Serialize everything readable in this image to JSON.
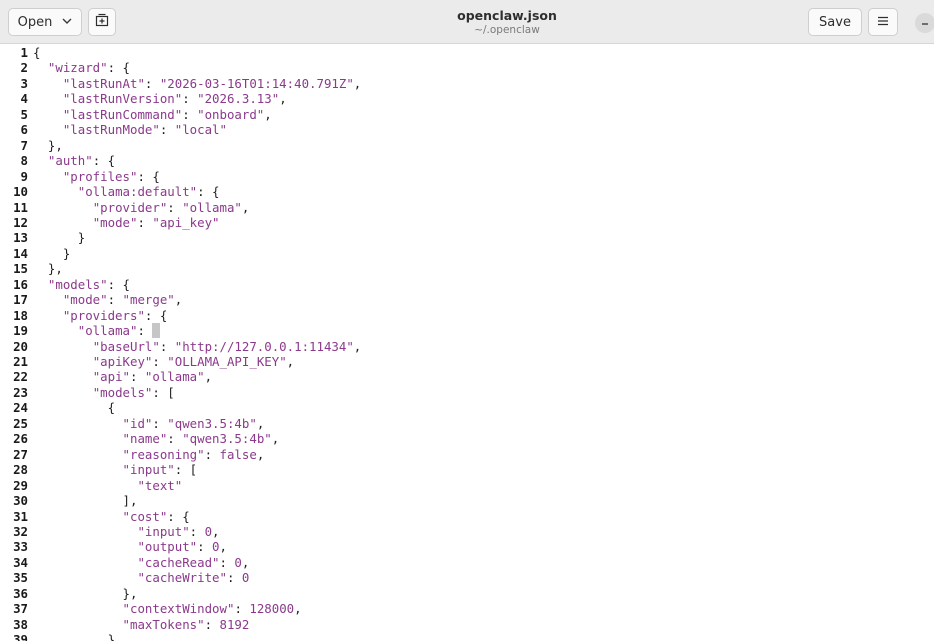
{
  "header": {
    "open_label": "Open",
    "title": "openclaw.json",
    "subtitle": "~/.openclaw",
    "save_label": "Save",
    "menu_icon": "hamburger-icon",
    "newtab_icon": "new-tab-icon",
    "minimize_icon": "minimize-icon"
  },
  "editor": {
    "lines": [
      {
        "n": "1",
        "t": [
          [
            "p",
            "{"
          ]
        ]
      },
      {
        "n": "2",
        "t": [
          [
            "p",
            "  "
          ],
          [
            "k",
            "\"wizard\""
          ],
          [
            "p",
            ": {"
          ]
        ]
      },
      {
        "n": "3",
        "t": [
          [
            "p",
            "    "
          ],
          [
            "k",
            "\"lastRunAt\""
          ],
          [
            "p",
            ": "
          ],
          [
            "s",
            "\"2026-03-16T01:14:40.791Z\""
          ],
          [
            "p",
            ","
          ]
        ]
      },
      {
        "n": "4",
        "t": [
          [
            "p",
            "    "
          ],
          [
            "k",
            "\"lastRunVersion\""
          ],
          [
            "p",
            ": "
          ],
          [
            "s",
            "\"2026.3.13\""
          ],
          [
            "p",
            ","
          ]
        ]
      },
      {
        "n": "5",
        "t": [
          [
            "p",
            "    "
          ],
          [
            "k",
            "\"lastRunCommand\""
          ],
          [
            "p",
            ": "
          ],
          [
            "s",
            "\"onboard\""
          ],
          [
            "p",
            ","
          ]
        ]
      },
      {
        "n": "6",
        "t": [
          [
            "p",
            "    "
          ],
          [
            "k",
            "\"lastRunMode\""
          ],
          [
            "p",
            ": "
          ],
          [
            "s",
            "\"local\""
          ]
        ]
      },
      {
        "n": "7",
        "t": [
          [
            "p",
            "  },"
          ]
        ]
      },
      {
        "n": "8",
        "t": [
          [
            "p",
            "  "
          ],
          [
            "k",
            "\"auth\""
          ],
          [
            "p",
            ": {"
          ]
        ]
      },
      {
        "n": "9",
        "t": [
          [
            "p",
            "    "
          ],
          [
            "k",
            "\"profiles\""
          ],
          [
            "p",
            ": {"
          ]
        ]
      },
      {
        "n": "10",
        "t": [
          [
            "p",
            "      "
          ],
          [
            "k",
            "\"ollama:default\""
          ],
          [
            "p",
            ": {"
          ]
        ]
      },
      {
        "n": "11",
        "t": [
          [
            "p",
            "        "
          ],
          [
            "k",
            "\"provider\""
          ],
          [
            "p",
            ": "
          ],
          [
            "s",
            "\"ollama\""
          ],
          [
            "p",
            ","
          ]
        ]
      },
      {
        "n": "12",
        "t": [
          [
            "p",
            "        "
          ],
          [
            "k",
            "\"mode\""
          ],
          [
            "p",
            ": "
          ],
          [
            "s",
            "\"api_key\""
          ]
        ]
      },
      {
        "n": "13",
        "t": [
          [
            "p",
            "      }"
          ]
        ]
      },
      {
        "n": "14",
        "t": [
          [
            "p",
            "    }"
          ]
        ]
      },
      {
        "n": "15",
        "t": [
          [
            "p",
            "  },"
          ]
        ]
      },
      {
        "n": "16",
        "t": [
          [
            "p",
            "  "
          ],
          [
            "k",
            "\"models\""
          ],
          [
            "p",
            ": {"
          ]
        ]
      },
      {
        "n": "17",
        "t": [
          [
            "p",
            "    "
          ],
          [
            "k",
            "\"mode\""
          ],
          [
            "p",
            ": "
          ],
          [
            "s",
            "\"merge\""
          ],
          [
            "p",
            ","
          ]
        ]
      },
      {
        "n": "18",
        "t": [
          [
            "p",
            "    "
          ],
          [
            "k",
            "\"providers\""
          ],
          [
            "p",
            ": {"
          ]
        ]
      },
      {
        "n": "19",
        "t": [
          [
            "p",
            "      "
          ],
          [
            "k",
            "\"ollama\""
          ],
          [
            "p",
            ": "
          ],
          [
            "c",
            "{"
          ]
        ]
      },
      {
        "n": "20",
        "t": [
          [
            "p",
            "        "
          ],
          [
            "k",
            "\"baseUrl\""
          ],
          [
            "p",
            ": "
          ],
          [
            "s",
            "\"http://127.0.0.1:11434\""
          ],
          [
            "p",
            ","
          ]
        ]
      },
      {
        "n": "21",
        "t": [
          [
            "p",
            "        "
          ],
          [
            "k",
            "\"apiKey\""
          ],
          [
            "p",
            ": "
          ],
          [
            "s",
            "\"OLLAMA_API_KEY\""
          ],
          [
            "p",
            ","
          ]
        ]
      },
      {
        "n": "22",
        "t": [
          [
            "p",
            "        "
          ],
          [
            "k",
            "\"api\""
          ],
          [
            "p",
            ": "
          ],
          [
            "s",
            "\"ollama\""
          ],
          [
            "p",
            ","
          ]
        ]
      },
      {
        "n": "23",
        "t": [
          [
            "p",
            "        "
          ],
          [
            "k",
            "\"models\""
          ],
          [
            "p",
            ": ["
          ]
        ]
      },
      {
        "n": "24",
        "t": [
          [
            "p",
            "          {"
          ]
        ]
      },
      {
        "n": "25",
        "t": [
          [
            "p",
            "            "
          ],
          [
            "k",
            "\"id\""
          ],
          [
            "p",
            ": "
          ],
          [
            "s",
            "\"qwen3.5:4b\""
          ],
          [
            "p",
            ","
          ]
        ]
      },
      {
        "n": "26",
        "t": [
          [
            "p",
            "            "
          ],
          [
            "k",
            "\"name\""
          ],
          [
            "p",
            ": "
          ],
          [
            "s",
            "\"qwen3.5:4b\""
          ],
          [
            "p",
            ","
          ]
        ]
      },
      {
        "n": "27",
        "t": [
          [
            "p",
            "            "
          ],
          [
            "k",
            "\"reasoning\""
          ],
          [
            "p",
            ": "
          ],
          [
            "w",
            "false"
          ],
          [
            "p",
            ","
          ]
        ]
      },
      {
        "n": "28",
        "t": [
          [
            "p",
            "            "
          ],
          [
            "k",
            "\"input\""
          ],
          [
            "p",
            ": ["
          ]
        ]
      },
      {
        "n": "29",
        "t": [
          [
            "p",
            "              "
          ],
          [
            "s",
            "\"text\""
          ]
        ]
      },
      {
        "n": "30",
        "t": [
          [
            "p",
            "            ],"
          ]
        ]
      },
      {
        "n": "31",
        "t": [
          [
            "p",
            "            "
          ],
          [
            "k",
            "\"cost\""
          ],
          [
            "p",
            ": {"
          ]
        ]
      },
      {
        "n": "32",
        "t": [
          [
            "p",
            "              "
          ],
          [
            "k",
            "\"input\""
          ],
          [
            "p",
            ": "
          ],
          [
            "d",
            "0"
          ],
          [
            "p",
            ","
          ]
        ]
      },
      {
        "n": "33",
        "t": [
          [
            "p",
            "              "
          ],
          [
            "k",
            "\"output\""
          ],
          [
            "p",
            ": "
          ],
          [
            "d",
            "0"
          ],
          [
            "p",
            ","
          ]
        ]
      },
      {
        "n": "34",
        "t": [
          [
            "p",
            "              "
          ],
          [
            "k",
            "\"cacheRead\""
          ],
          [
            "p",
            ": "
          ],
          [
            "d",
            "0"
          ],
          [
            "p",
            ","
          ]
        ]
      },
      {
        "n": "35",
        "t": [
          [
            "p",
            "              "
          ],
          [
            "k",
            "\"cacheWrite\""
          ],
          [
            "p",
            ": "
          ],
          [
            "d",
            "0"
          ]
        ]
      },
      {
        "n": "36",
        "t": [
          [
            "p",
            "            },"
          ]
        ]
      },
      {
        "n": "37",
        "t": [
          [
            "p",
            "            "
          ],
          [
            "k",
            "\"contextWindow\""
          ],
          [
            "p",
            ": "
          ],
          [
            "d",
            "128000"
          ],
          [
            "p",
            ","
          ]
        ]
      },
      {
        "n": "38",
        "t": [
          [
            "p",
            "            "
          ],
          [
            "k",
            "\"maxTokens\""
          ],
          [
            "p",
            ": "
          ],
          [
            "d",
            "8192"
          ]
        ]
      },
      {
        "n": "39",
        "t": [
          [
            "p",
            "          }"
          ]
        ]
      }
    ]
  },
  "colors": {
    "headerbar": "#ebebeb",
    "token": "#8b3a8b",
    "text": "#1e1e1e"
  }
}
